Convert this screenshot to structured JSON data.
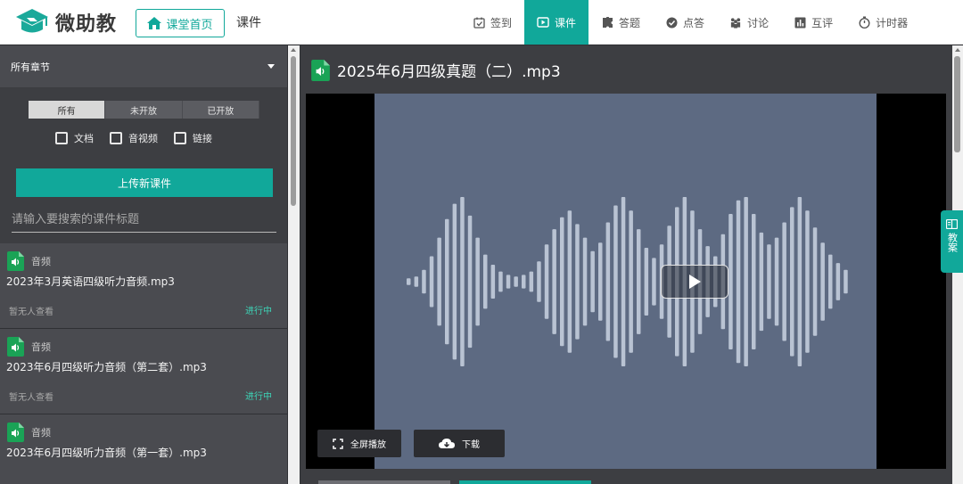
{
  "app": {
    "logo_text": "微助教"
  },
  "header": {
    "home_button": "课堂首页",
    "breadcrumb": "课件",
    "nav": [
      {
        "label": "签到",
        "icon": "calendar-check-icon",
        "active": false
      },
      {
        "label": "课件",
        "icon": "play-square-icon",
        "active": true
      },
      {
        "label": "答题",
        "icon": "puzzle-icon",
        "active": false
      },
      {
        "label": "点答",
        "icon": "check-circle-icon",
        "active": false
      },
      {
        "label": "讨论",
        "icon": "people-icon",
        "active": false
      },
      {
        "label": "互评",
        "icon": "bar-chart-icon",
        "active": false
      },
      {
        "label": "计时器",
        "icon": "stopwatch-icon",
        "active": false
      }
    ]
  },
  "sidebar": {
    "chapter_select": "所有章节",
    "filters": [
      "所有",
      "未开放",
      "已开放"
    ],
    "active_filter": "所有",
    "checkboxes": [
      "文档",
      "音视频",
      "链接"
    ],
    "upload_button": "上传新课件",
    "search_placeholder": "请输入要搜索的课件标题",
    "files": [
      {
        "type": "音频",
        "name": "2023年3月英语四级听力音频.mp3",
        "views": "暂无人查看",
        "status": "进行中"
      },
      {
        "type": "音频",
        "name": "2023年6月四级听力音频（第二套）.mp3",
        "views": "暂无人查看",
        "status": "进行中"
      },
      {
        "type": "音频",
        "name": "2023年6月四级听力音频（第一套）.mp3",
        "views": "",
        "status": ""
      }
    ]
  },
  "main": {
    "title": "2025年6月四级真题（二）.mp3",
    "fullscreen_button": "全屏播放",
    "download_button": "下载"
  },
  "side_tab": {
    "label": "教案"
  },
  "colors": {
    "accent": "#11a89a",
    "status_green": "#3dd6b8",
    "poster": "#5d6a82"
  }
}
